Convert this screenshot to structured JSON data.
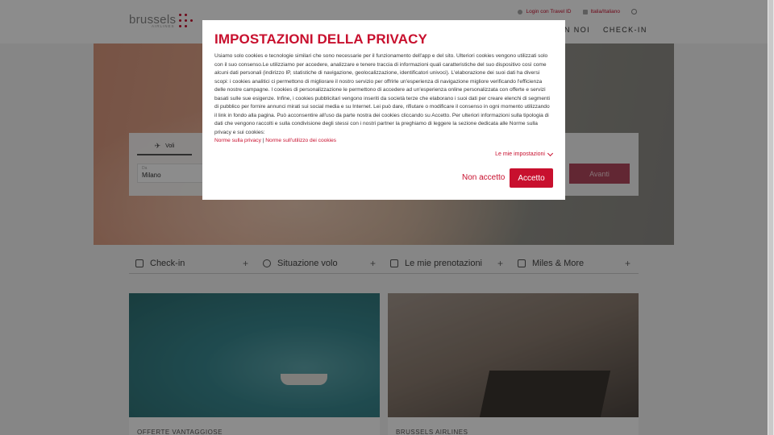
{
  "header": {
    "logo_text": "brussels",
    "logo_sub": "AIRLINES",
    "login_label": "Login con Travel ID",
    "country_label": "Italia/Italiano",
    "nav_items": [
      "N NOI",
      "CHECK-IN"
    ]
  },
  "booking": {
    "tab_label": "Voli",
    "from_label": "Da",
    "from_value": "Milano",
    "submit_label": "Avanti"
  },
  "quick_links": [
    {
      "label": "Check-in",
      "icon": "checkin-icon"
    },
    {
      "label": "Situazione volo",
      "icon": "clock-icon"
    },
    {
      "label": "Le mie prenotazioni",
      "icon": "bookings-icon"
    },
    {
      "label": "Miles & More",
      "icon": "card-icon"
    }
  ],
  "cards": [
    {
      "caption": "OFFERTE VANTAGGIOSE"
    },
    {
      "caption": "BRUSSELS AIRLINES"
    }
  ],
  "privacy": {
    "title": "IMPOSTAZIONI DELLA PRIVACY",
    "text": "Usiamo solo cookies e tecnologie similari che sono necessarie per il funzionamento dell'app e del sito. Ulteriori cookies vengono utilizzati solo con il suo consenso.Le utilizziamo per accedere, analizzare e tenere traccia di informazioni quali caratteristiche del suo dispositivo così come alcuni dati personali (indirizzo IP, statistiche di navigazione, geolocalizzazione, identificatori univoci). L'elaborazione dei suoi dati ha diversi scopi: i cookies analitici ci permettono di migliorare il nostro servizio per offrirle un'esperienza di navigazione migliore verificando l'efficienza delle nostre campagne. I cookies di personalizzazione le permettono di accedere ad un'esperienza online personalizzata con offerte e servizi basati sulle sue esigenze. Infine, i cookies pubblicitari vengono inseriti da società terze che elaborano i suoi dati per creare elenchi di segmenti di pubblico per fornire annunci mirati sui social media e su Internet. Lei può dare, rifiutare o modificare il consenso in ogni momento utilizzando il link in fondo alla pagina. Può acconsentire all'uso da parte nostra dei cookies cliccando su Accetto. Per ulteriori informazioni sulla tipologia di dati che vengono raccolti e sulla condivisione degli stessi con i nostri partner la preghiamo di leggere la sezione dedicata alle Norme sulla privacy e sui cookies:",
    "link_privacy": "Norme sulla privacy",
    "link_separator": " | ",
    "link_cookies": "Norme sull'utilizzo dei cookies",
    "settings_label": "Le mie impostazioni",
    "refuse_label": "Non accetto",
    "accept_label": "Accetto"
  },
  "colors": {
    "brand_red": "#c8102e"
  }
}
